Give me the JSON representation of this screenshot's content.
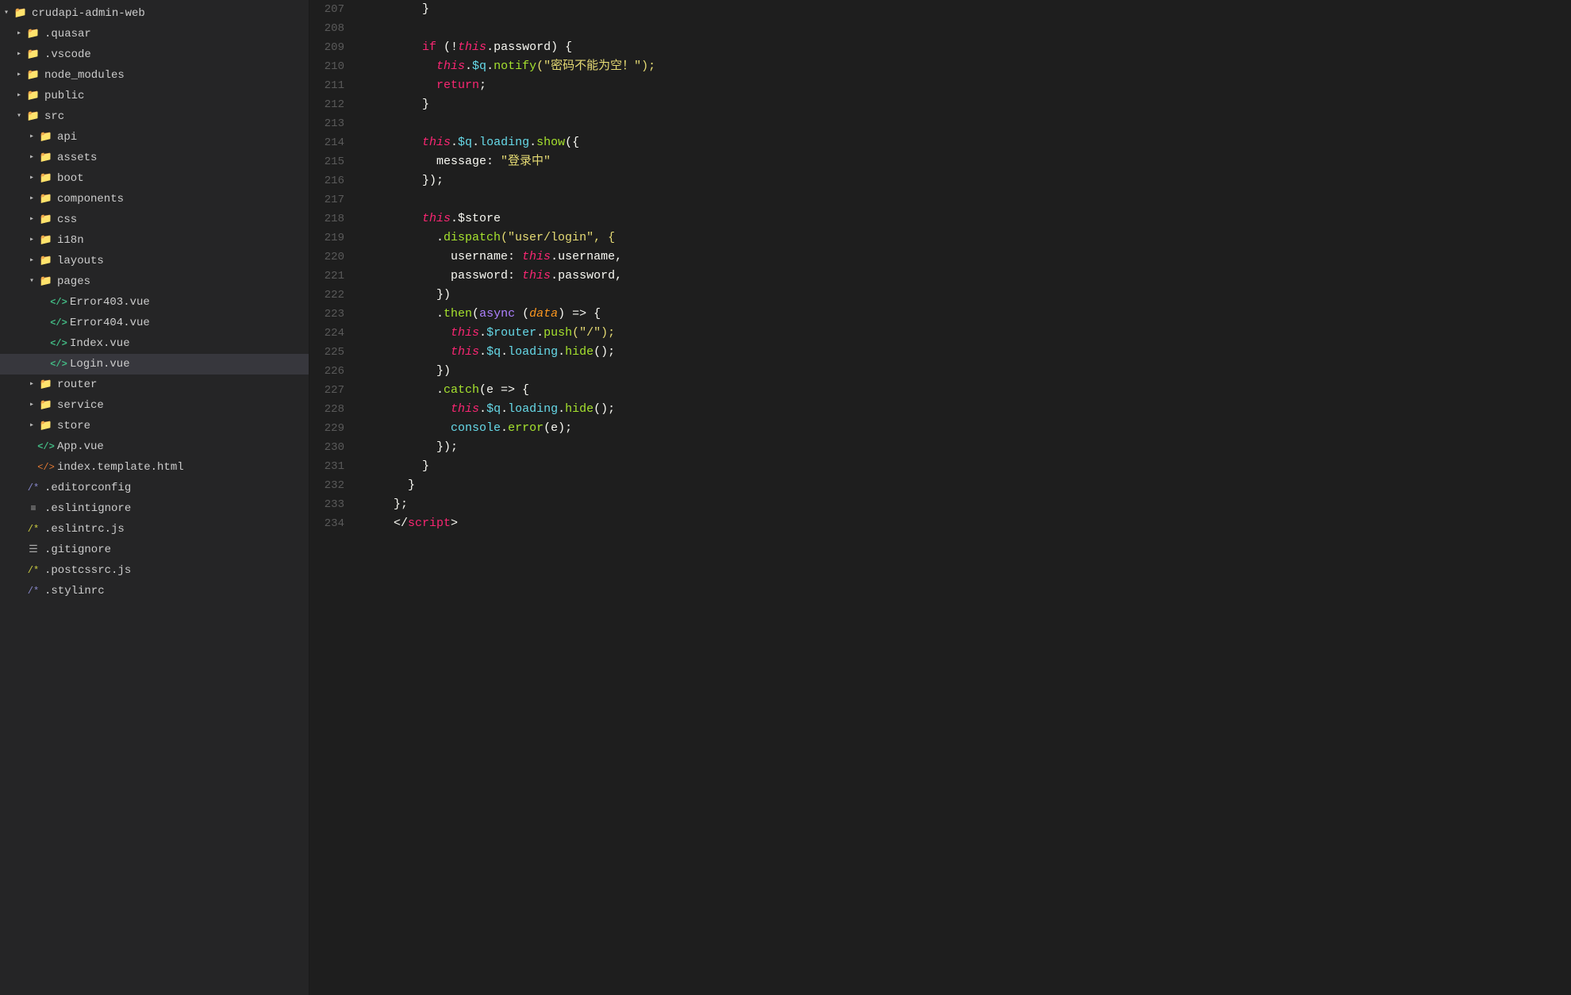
{
  "sidebar": {
    "items": [
      {
        "id": "crudapi-admin-web",
        "label": "crudapi-admin-web",
        "type": "root-folder",
        "indent": 0,
        "expanded": true,
        "arrow": "▾"
      },
      {
        "id": "quasar",
        "label": ".quasar",
        "type": "folder",
        "indent": 1,
        "expanded": false,
        "arrow": "▸"
      },
      {
        "id": "vscode",
        "label": ".vscode",
        "type": "folder",
        "indent": 1,
        "expanded": false,
        "arrow": "▸"
      },
      {
        "id": "node_modules",
        "label": "node_modules",
        "type": "folder",
        "indent": 1,
        "expanded": false,
        "arrow": "▸"
      },
      {
        "id": "public",
        "label": "public",
        "type": "folder",
        "indent": 1,
        "expanded": false,
        "arrow": "▸"
      },
      {
        "id": "src",
        "label": "src",
        "type": "folder",
        "indent": 1,
        "expanded": true,
        "arrow": "▾"
      },
      {
        "id": "api",
        "label": "api",
        "type": "folder",
        "indent": 2,
        "expanded": false,
        "arrow": "▸"
      },
      {
        "id": "assets",
        "label": "assets",
        "type": "folder",
        "indent": 2,
        "expanded": false,
        "arrow": "▸"
      },
      {
        "id": "boot",
        "label": "boot",
        "type": "folder",
        "indent": 2,
        "expanded": false,
        "arrow": "▸"
      },
      {
        "id": "components",
        "label": "components",
        "type": "folder",
        "indent": 2,
        "expanded": false,
        "arrow": "▸"
      },
      {
        "id": "css",
        "label": "css",
        "type": "folder",
        "indent": 2,
        "expanded": false,
        "arrow": "▸"
      },
      {
        "id": "i18n",
        "label": "i18n",
        "type": "folder",
        "indent": 2,
        "expanded": false,
        "arrow": "▸"
      },
      {
        "id": "layouts",
        "label": "layouts",
        "type": "folder",
        "indent": 2,
        "expanded": false,
        "arrow": "▸"
      },
      {
        "id": "pages",
        "label": "pages",
        "type": "folder",
        "indent": 2,
        "expanded": true,
        "arrow": "▾"
      },
      {
        "id": "Error403",
        "label": "Error403.vue",
        "type": "vue",
        "indent": 3,
        "expanded": false,
        "arrow": ""
      },
      {
        "id": "Error404",
        "label": "Error404.vue",
        "type": "vue",
        "indent": 3,
        "expanded": false,
        "arrow": ""
      },
      {
        "id": "Index",
        "label": "Index.vue",
        "type": "vue",
        "indent": 3,
        "expanded": false,
        "arrow": ""
      },
      {
        "id": "Login",
        "label": "Login.vue",
        "type": "vue",
        "indent": 3,
        "expanded": false,
        "arrow": "",
        "selected": true
      },
      {
        "id": "router",
        "label": "router",
        "type": "folder",
        "indent": 2,
        "expanded": false,
        "arrow": "▸"
      },
      {
        "id": "service",
        "label": "service",
        "type": "folder",
        "indent": 2,
        "expanded": false,
        "arrow": "▸"
      },
      {
        "id": "store",
        "label": "store",
        "type": "folder",
        "indent": 2,
        "expanded": false,
        "arrow": "▸"
      },
      {
        "id": "App",
        "label": "App.vue",
        "type": "vue",
        "indent": 2,
        "expanded": false,
        "arrow": ""
      },
      {
        "id": "index_template",
        "label": "index.template.html",
        "type": "html",
        "indent": 2,
        "expanded": false,
        "arrow": ""
      },
      {
        "id": "editorconfig",
        "label": ".editorconfig",
        "type": "config",
        "indent": 1,
        "expanded": false,
        "arrow": ""
      },
      {
        "id": "eslintignore",
        "label": ".eslintignore",
        "type": "text",
        "indent": 1,
        "expanded": false,
        "arrow": ""
      },
      {
        "id": "eslintrc",
        "label": ".eslintrc.js",
        "type": "js",
        "indent": 1,
        "expanded": false,
        "arrow": ""
      },
      {
        "id": "gitignore",
        "label": ".gitignore",
        "type": "git",
        "indent": 1,
        "expanded": false,
        "arrow": ""
      },
      {
        "id": "postcssrc",
        "label": ".postcssrc.js",
        "type": "js",
        "indent": 1,
        "expanded": false,
        "arrow": ""
      },
      {
        "id": "stylinrc",
        "label": ".stylinrc",
        "type": "config",
        "indent": 1,
        "expanded": false,
        "arrow": ""
      }
    ]
  },
  "editor": {
    "lines": [
      {
        "num": 207,
        "tokens": [
          {
            "t": "        }",
            "c": "plain"
          }
        ]
      },
      {
        "num": 208,
        "tokens": []
      },
      {
        "num": 209,
        "tokens": [
          {
            "t": "        ",
            "c": "plain"
          },
          {
            "t": "if",
            "c": "kw-pink"
          },
          {
            "t": " (!",
            "c": "plain"
          },
          {
            "t": "this",
            "c": "kw-this"
          },
          {
            "t": ".password) {",
            "c": "plain"
          }
        ]
      },
      {
        "num": 210,
        "tokens": [
          {
            "t": "          ",
            "c": "plain"
          },
          {
            "t": "this",
            "c": "kw-this"
          },
          {
            "t": ".",
            "c": "plain"
          },
          {
            "t": "$q",
            "c": "kw-method"
          },
          {
            "t": ".",
            "c": "plain"
          },
          {
            "t": "notify",
            "c": "kw-cyan"
          },
          {
            "t": "(\"密码不能为空！\");",
            "c": "kw-string"
          }
        ]
      },
      {
        "num": 211,
        "tokens": [
          {
            "t": "          ",
            "c": "plain"
          },
          {
            "t": "return",
            "c": "kw-pink"
          },
          {
            "t": ";",
            "c": "plain"
          }
        ]
      },
      {
        "num": 212,
        "tokens": [
          {
            "t": "        }",
            "c": "plain"
          }
        ]
      },
      {
        "num": 213,
        "tokens": []
      },
      {
        "num": 214,
        "tokens": [
          {
            "t": "        ",
            "c": "plain"
          },
          {
            "t": "this",
            "c": "kw-this"
          },
          {
            "t": ".",
            "c": "plain"
          },
          {
            "t": "$q",
            "c": "kw-method"
          },
          {
            "t": ".",
            "c": "plain"
          },
          {
            "t": "loading",
            "c": "kw-method"
          },
          {
            "t": ".",
            "c": "plain"
          },
          {
            "t": "show",
            "c": "kw-cyan"
          },
          {
            "t": "({",
            "c": "plain"
          }
        ]
      },
      {
        "num": 215,
        "tokens": [
          {
            "t": "          message: ",
            "c": "plain"
          },
          {
            "t": "\"登录中\"",
            "c": "kw-string"
          }
        ]
      },
      {
        "num": 216,
        "tokens": [
          {
            "t": "        });",
            "c": "plain"
          }
        ]
      },
      {
        "num": 217,
        "tokens": []
      },
      {
        "num": 218,
        "tokens": [
          {
            "t": "        ",
            "c": "plain"
          },
          {
            "t": "this",
            "c": "kw-this"
          },
          {
            "t": ".$store",
            "c": "plain"
          }
        ]
      },
      {
        "num": 219,
        "tokens": [
          {
            "t": "          .",
            "c": "plain"
          },
          {
            "t": "dispatch",
            "c": "kw-cyan"
          },
          {
            "t": "(\"user/login\", {",
            "c": "kw-string"
          }
        ]
      },
      {
        "num": 220,
        "tokens": [
          {
            "t": "            username: ",
            "c": "plain"
          },
          {
            "t": "this",
            "c": "kw-this"
          },
          {
            "t": ".username,",
            "c": "plain"
          }
        ]
      },
      {
        "num": 221,
        "tokens": [
          {
            "t": "            password: ",
            "c": "plain"
          },
          {
            "t": "this",
            "c": "kw-this"
          },
          {
            "t": ".password,",
            "c": "plain"
          }
        ]
      },
      {
        "num": 222,
        "tokens": [
          {
            "t": "          })",
            "c": "plain"
          }
        ]
      },
      {
        "num": 223,
        "tokens": [
          {
            "t": "          .",
            "c": "plain"
          },
          {
            "t": "then",
            "c": "kw-cyan"
          },
          {
            "t": "(",
            "c": "plain"
          },
          {
            "t": "async",
            "c": "kw-purple"
          },
          {
            "t": " (",
            "c": "plain"
          },
          {
            "t": "data",
            "c": "kw-param"
          },
          {
            "t": ") => {",
            "c": "plain"
          }
        ]
      },
      {
        "num": 224,
        "tokens": [
          {
            "t": "            ",
            "c": "plain"
          },
          {
            "t": "this",
            "c": "kw-this"
          },
          {
            "t": ".",
            "c": "plain"
          },
          {
            "t": "$router",
            "c": "kw-method"
          },
          {
            "t": ".",
            "c": "plain"
          },
          {
            "t": "push",
            "c": "kw-cyan"
          },
          {
            "t": "(\"/\");",
            "c": "kw-string"
          }
        ]
      },
      {
        "num": 225,
        "tokens": [
          {
            "t": "            ",
            "c": "plain"
          },
          {
            "t": "this",
            "c": "kw-this"
          },
          {
            "t": ".",
            "c": "plain"
          },
          {
            "t": "$q",
            "c": "kw-method"
          },
          {
            "t": ".",
            "c": "plain"
          },
          {
            "t": "loading",
            "c": "kw-method"
          },
          {
            "t": ".",
            "c": "plain"
          },
          {
            "t": "hide",
            "c": "kw-cyan"
          },
          {
            "t": "();",
            "c": "plain"
          }
        ]
      },
      {
        "num": 226,
        "tokens": [
          {
            "t": "          })",
            "c": "plain"
          }
        ]
      },
      {
        "num": 227,
        "tokens": [
          {
            "t": "          .",
            "c": "plain"
          },
          {
            "t": "catch",
            "c": "kw-cyan"
          },
          {
            "t": "(e => {",
            "c": "plain"
          }
        ]
      },
      {
        "num": 228,
        "tokens": [
          {
            "t": "            ",
            "c": "plain"
          },
          {
            "t": "this",
            "c": "kw-this"
          },
          {
            "t": ".",
            "c": "plain"
          },
          {
            "t": "$q",
            "c": "kw-method"
          },
          {
            "t": ".",
            "c": "plain"
          },
          {
            "t": "loading",
            "c": "kw-method"
          },
          {
            "t": ".",
            "c": "plain"
          },
          {
            "t": "hide",
            "c": "kw-cyan"
          },
          {
            "t": "();",
            "c": "plain"
          }
        ]
      },
      {
        "num": 229,
        "tokens": [
          {
            "t": "            ",
            "c": "plain"
          },
          {
            "t": "console",
            "c": "kw-method"
          },
          {
            "t": ".",
            "c": "plain"
          },
          {
            "t": "error",
            "c": "kw-cyan"
          },
          {
            "t": "(e);",
            "c": "plain"
          }
        ]
      },
      {
        "num": 230,
        "tokens": [
          {
            "t": "          });",
            "c": "plain"
          }
        ]
      },
      {
        "num": 231,
        "tokens": [
          {
            "t": "        }",
            "c": "plain"
          }
        ]
      },
      {
        "num": 232,
        "tokens": [
          {
            "t": "      }",
            "c": "plain"
          }
        ]
      },
      {
        "num": 233,
        "tokens": [
          {
            "t": "    };",
            "c": "plain"
          }
        ]
      },
      {
        "num": 234,
        "tokens": [
          {
            "t": "    </",
            "c": "plain"
          },
          {
            "t": "script",
            "c": "kw-tag"
          },
          {
            "t": ">",
            "c": "plain"
          }
        ]
      }
    ]
  }
}
